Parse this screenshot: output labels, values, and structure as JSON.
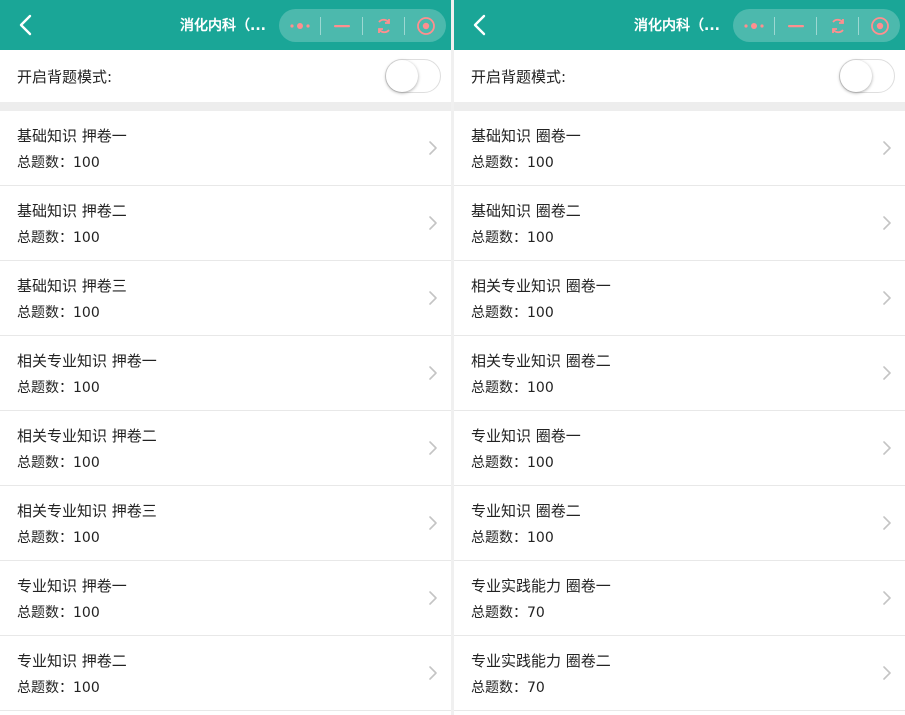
{
  "panels": [
    {
      "title": "消化内科（...",
      "toggle_label": "开启背题模式:",
      "toggle_on": false,
      "items": [
        {
          "title": "基础知识 押卷一",
          "count": "总题数：100"
        },
        {
          "title": "基础知识 押卷二",
          "count": "总题数：100"
        },
        {
          "title": "基础知识 押卷三",
          "count": "总题数：100"
        },
        {
          "title": "相关专业知识 押卷一",
          "count": "总题数：100"
        },
        {
          "title": "相关专业知识 押卷二",
          "count": "总题数：100"
        },
        {
          "title": "相关专业知识 押卷三",
          "count": "总题数：100"
        },
        {
          "title": "专业知识 押卷一",
          "count": "总题数：100"
        },
        {
          "title": "专业知识 押卷二",
          "count": "总题数：100"
        }
      ]
    },
    {
      "title": "消化内科（...",
      "toggle_label": "开启背题模式:",
      "toggle_on": false,
      "items": [
        {
          "title": "基础知识 圈卷一",
          "count": "总题数：100"
        },
        {
          "title": "基础知识 圈卷二",
          "count": "总题数：100"
        },
        {
          "title": "相关专业知识 圈卷一",
          "count": "总题数：100"
        },
        {
          "title": "相关专业知识 圈卷二",
          "count": "总题数：100"
        },
        {
          "title": "专业知识 圈卷一",
          "count": "总题数：100"
        },
        {
          "title": "专业知识 圈卷二",
          "count": "总题数：100"
        },
        {
          "title": "专业实践能力 圈卷一",
          "count": "总题数：70"
        },
        {
          "title": "专业实践能力 圈卷二",
          "count": "总题数：70"
        }
      ]
    }
  ],
  "icons": {
    "back": "back-arrow-icon",
    "more": "more-dots-icon",
    "minimize": "minimize-icon",
    "refresh": "refresh-icon",
    "close": "close-circle-icon",
    "chevron": "chevron-right-icon"
  },
  "colors": {
    "header_bg": "#1aa697",
    "page_bg": "#f0f0f0",
    "text": "#222222",
    "chevron": "#c4c4c4"
  }
}
